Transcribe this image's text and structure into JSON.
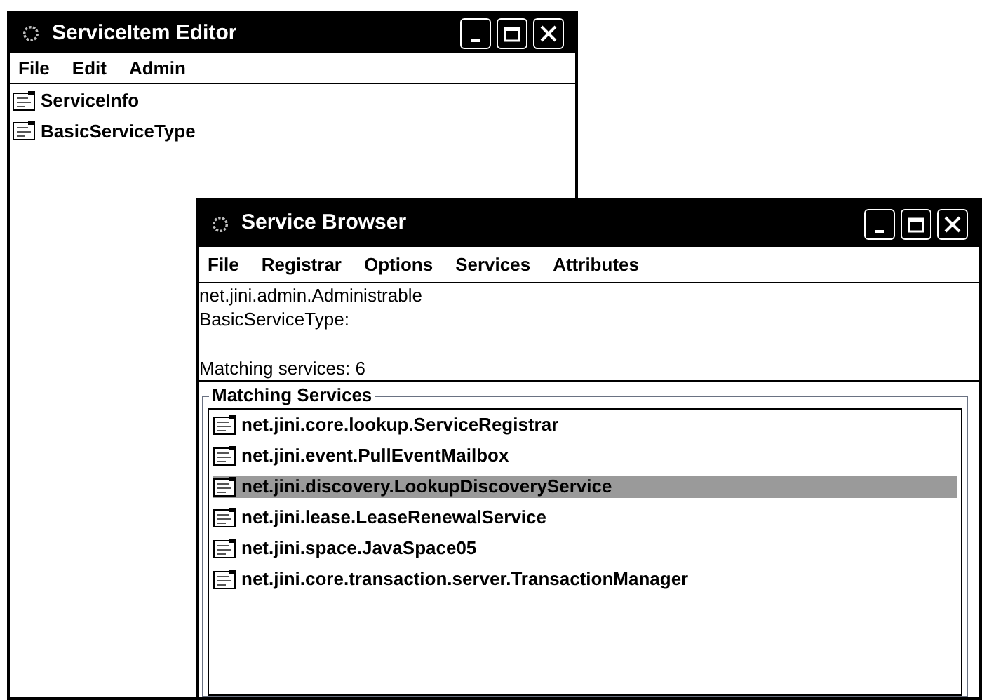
{
  "editor": {
    "title": "ServiceItem Editor",
    "menus": [
      "File",
      "Edit",
      "Admin"
    ],
    "items": [
      {
        "label": "ServiceInfo"
      },
      {
        "label": "BasicServiceType"
      }
    ]
  },
  "browser": {
    "title": "Service Browser",
    "menus": [
      "File",
      "Registrar",
      "Options",
      "Services",
      "Attributes"
    ],
    "info_lines": [
      "net.jini.admin.Administrable",
      "BasicServiceType:"
    ],
    "match_count": "Matching services: 6",
    "panel_title": "Matching Services",
    "services": [
      {
        "label": "net.jini.core.lookup.ServiceRegistrar",
        "selected": false
      },
      {
        "label": "net.jini.event.PullEventMailbox",
        "selected": false
      },
      {
        "label": "net.jini.discovery.LookupDiscoveryService",
        "selected": true
      },
      {
        "label": "net.jini.lease.LeaseRenewalService",
        "selected": false
      },
      {
        "label": "net.jini.space.JavaSpace05",
        "selected": false
      },
      {
        "label": "net.jini.core.transaction.server.TransactionManager",
        "selected": false
      }
    ]
  }
}
